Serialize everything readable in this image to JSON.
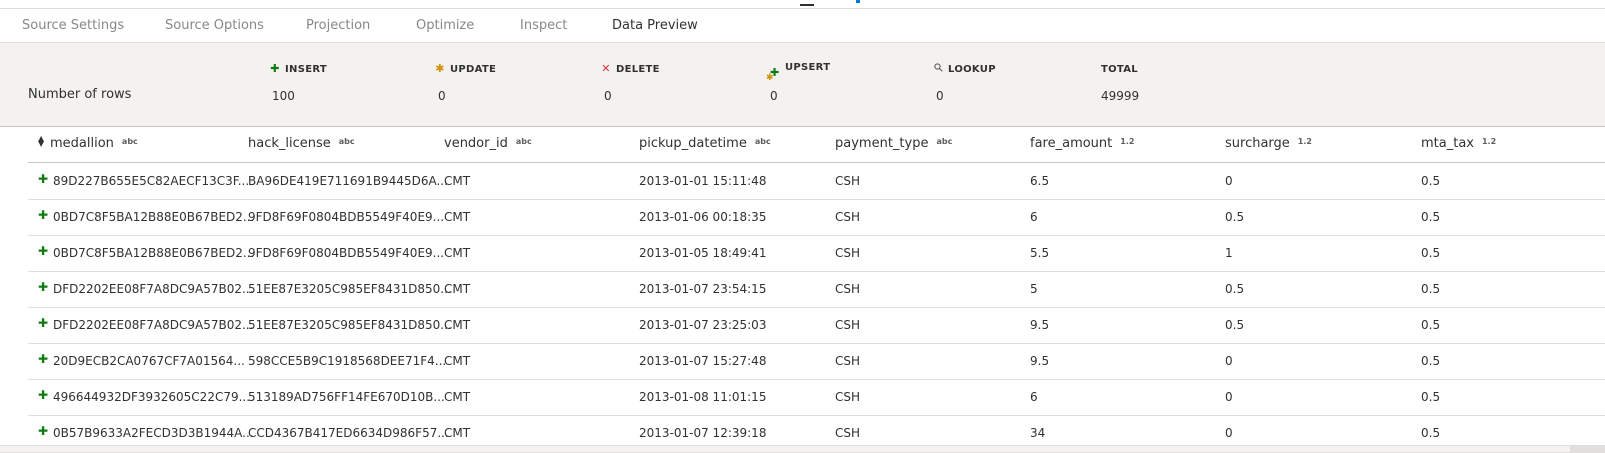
{
  "tabs": [
    {
      "label": "Source Settings"
    },
    {
      "label": "Source Options"
    },
    {
      "label": "Projection"
    },
    {
      "label": "Optimize"
    },
    {
      "label": "Inspect"
    },
    {
      "label": "Data Preview",
      "active": true
    }
  ],
  "summary": {
    "row_label": "Number of rows",
    "insert": {
      "label": "INSERT",
      "value": "100",
      "icon": "plus-icon"
    },
    "update": {
      "label": "UPDATE",
      "value": "0",
      "icon": "asterisk-icon"
    },
    "delete": {
      "label": "DELETE",
      "value": "0",
      "icon": "x-icon"
    },
    "upsert": {
      "label": "UPSERT",
      "value": "0",
      "icon": "upsert-icon"
    },
    "lookup": {
      "label": "LOOKUP",
      "value": "0",
      "icon": "search-icon"
    },
    "total": {
      "label": "TOTAL",
      "value": "49999"
    }
  },
  "columns": [
    {
      "name": "medallion",
      "type": "abc"
    },
    {
      "name": "hack_license",
      "type": "abc"
    },
    {
      "name": "vendor_id",
      "type": "abc"
    },
    {
      "name": "pickup_datetime",
      "type": "abc"
    },
    {
      "name": "payment_type",
      "type": "abc"
    },
    {
      "name": "fare_amount",
      "type": "1.2"
    },
    {
      "name": "surcharge",
      "type": "1.2"
    },
    {
      "name": "mta_tax",
      "type": "1.2"
    }
  ],
  "rows": [
    [
      "89D227B655E5C82AECF13C3F...",
      "BA96DE419E711691B9445D6A...",
      "CMT",
      "2013-01-01 15:11:48",
      "CSH",
      "6.5",
      "0",
      "0.5"
    ],
    [
      "0BD7C8F5BA12B88E0B67BED2...",
      "9FD8F69F0804BDB5549F40E9...",
      "CMT",
      "2013-01-06 00:18:35",
      "CSH",
      "6",
      "0.5",
      "0.5"
    ],
    [
      "0BD7C8F5BA12B88E0B67BED2...",
      "9FD8F69F0804BDB5549F40E9...",
      "CMT",
      "2013-01-05 18:49:41",
      "CSH",
      "5.5",
      "1",
      "0.5"
    ],
    [
      "DFD2202EE08F7A8DC9A57B02...",
      "51EE87E3205C985EF8431D850...",
      "CMT",
      "2013-01-07 23:54:15",
      "CSH",
      "5",
      "0.5",
      "0.5"
    ],
    [
      "DFD2202EE08F7A8DC9A57B02...",
      "51EE87E3205C985EF8431D850...",
      "CMT",
      "2013-01-07 23:25:03",
      "CSH",
      "9.5",
      "0.5",
      "0.5"
    ],
    [
      "20D9ECB2CA0767CF7A01564...",
      "598CCE5B9C1918568DEE71F4...",
      "CMT",
      "2013-01-07 15:27:48",
      "CSH",
      "9.5",
      "0",
      "0.5"
    ],
    [
      "496644932DF3932605C22C79...",
      "513189AD756FF14FE670D10B...",
      "CMT",
      "2013-01-08 11:01:15",
      "CSH",
      "6",
      "0",
      "0.5"
    ],
    [
      "0B57B9633A2FECD3D3B1944A...",
      "CCD4367B417ED6634D986F57...",
      "CMT",
      "2013-01-07 12:39:18",
      "CSH",
      "34",
      "0",
      "0.5"
    ]
  ]
}
